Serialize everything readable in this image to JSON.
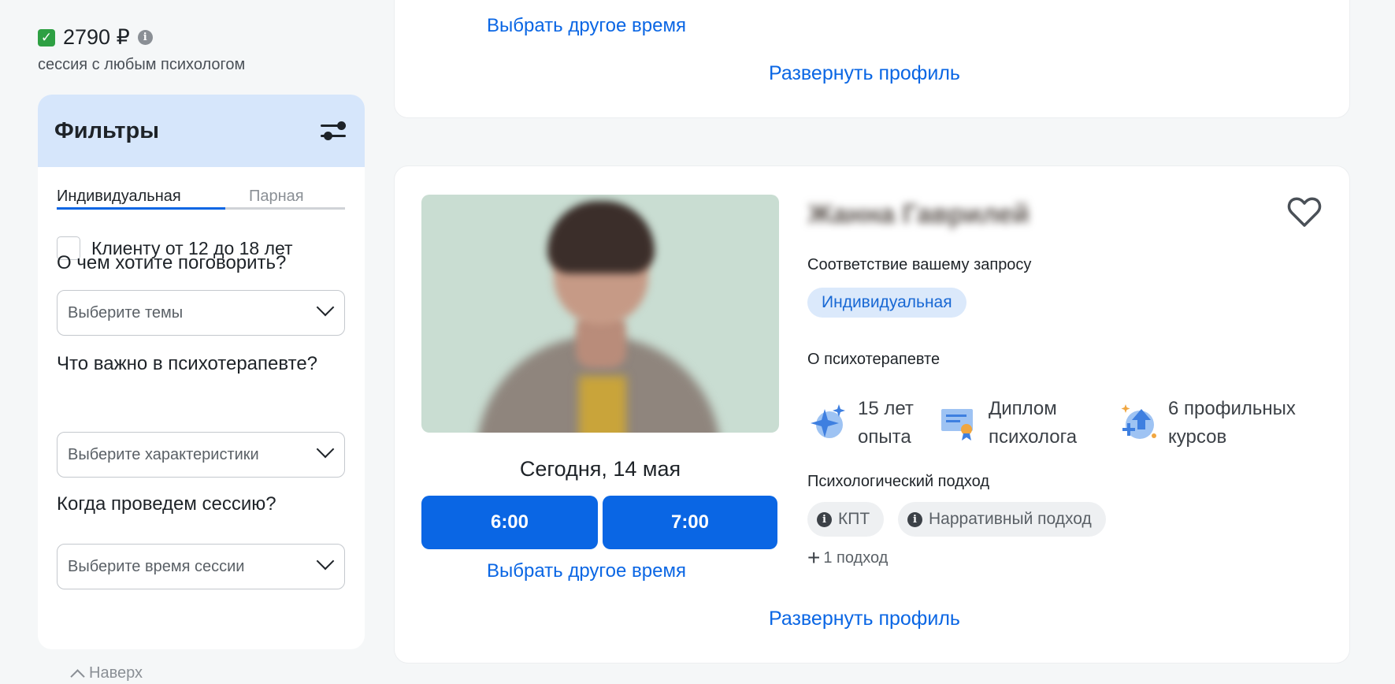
{
  "sidebar": {
    "price": "2790 ₽",
    "price_subtitle": "сессия с любым психологом",
    "filters": {
      "title": "Фильтры",
      "tabs": [
        "Индивидуальная",
        "Парная"
      ],
      "active_tab": "Индивидуальная",
      "teen_checkbox_label": "Клиенту от 12 до 18 лет",
      "topics_question": "О чем хотите поговорить?",
      "topics_placeholder": "Выберите темы",
      "traits_question": "Что важно в психотерапевте?",
      "traits_placeholder": "Выберите характеристики",
      "time_question": "Когда проведем сессию?",
      "time_placeholder": "Выберите время сессии"
    },
    "back_to_top": "Наверх"
  },
  "card_top": {
    "other_time": "Выбрать другое время",
    "expand_profile": "Развернуть профиль"
  },
  "card_main": {
    "name": "Жанна Гаврилей",
    "match_label": "Соответствие вашему запросу",
    "match_tag": "Индивидуальная",
    "about_label": "О психотерапевте",
    "stats": [
      {
        "line1": "15 лет",
        "line2": "опыта"
      },
      {
        "line1": "Диплом",
        "line2": "психолога"
      },
      {
        "line1": "6 профильных",
        "line2": "курсов"
      }
    ],
    "approach_label": "Психологический подход",
    "approaches": [
      "КПТ",
      "Нарративный подход"
    ],
    "more_approaches": "1 подход",
    "date": "Сегодня, 14 мая",
    "slots": [
      "6:00",
      "7:00"
    ],
    "other_time": "Выбрать другое время",
    "expand_profile": "Развернуть профиль"
  },
  "colors": {
    "accent": "#0a66e4",
    "filters_header": "#d6e6fb",
    "page_bg": "#f5f7f8"
  }
}
